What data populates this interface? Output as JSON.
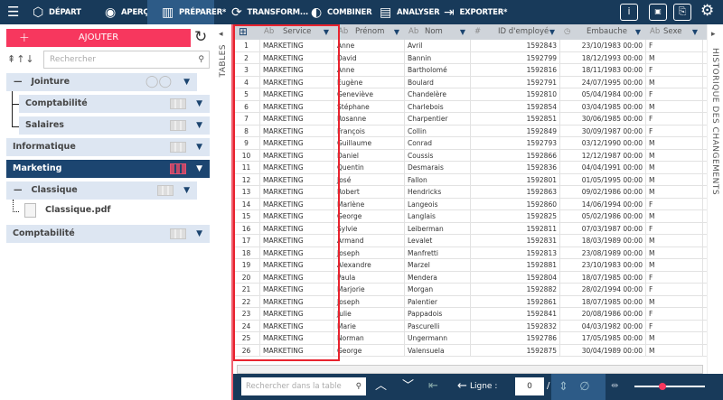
{
  "toolbar": {
    "items": [
      {
        "label": "DÉPART",
        "icon": "cube-icon",
        "glyph": "⬡"
      },
      {
        "label": "APERÇU",
        "icon": "eye-icon",
        "glyph": "◉"
      },
      {
        "label": "PRÉPARER*",
        "icon": "panel-icon",
        "glyph": "▥"
      },
      {
        "label": "TRANSFORM...",
        "icon": "transform-icon",
        "glyph": "⟳"
      },
      {
        "label": "COMBINER",
        "icon": "combine-icon",
        "glyph": "◐"
      },
      {
        "label": "ANALYSER",
        "icon": "clipboard-icon",
        "glyph": "▤"
      },
      {
        "label": "EXPORTER*",
        "icon": "export-icon",
        "glyph": "⇥"
      }
    ],
    "active": "PRÉPARER*"
  },
  "left": {
    "add_label": "AJOUTER",
    "search_placeholder": "Rechercher",
    "items": [
      {
        "label": "Jointure",
        "collapse": "—"
      },
      {
        "label": "Comptabilité"
      },
      {
        "label": "Salaires"
      },
      {
        "label": "Informatique"
      },
      {
        "label": "Marketing",
        "selected": true
      },
      {
        "label": "Classique",
        "collapse": "—"
      },
      {
        "label": "Classique.pdf"
      },
      {
        "label": "Comptabilité"
      }
    ],
    "tables_tab": "TABLES"
  },
  "grid": {
    "columns": [
      {
        "type": "Ab",
        "label": "Service"
      },
      {
        "type": "Ab",
        "label": "Prénom"
      },
      {
        "type": "Ab",
        "label": "Nom"
      },
      {
        "type": "#",
        "label": "ID d'employé"
      },
      {
        "type": "◷",
        "label": "Embauche"
      },
      {
        "type": "Ab",
        "label": "Sexe"
      }
    ],
    "rows": [
      [
        "1",
        "MARKETING",
        "Anne",
        "Avril",
        "1592843",
        "23/10/1983 00:00",
        "F"
      ],
      [
        "2",
        "MARKETING",
        "David",
        "Bannin",
        "1592799",
        "18/12/1993 00:00",
        "M"
      ],
      [
        "3",
        "MARKETING",
        "Anne",
        "Bartholomé",
        "1592816",
        "18/11/1983 00:00",
        "F"
      ],
      [
        "4",
        "MARKETING",
        "Eugène",
        "Boulard",
        "1592791",
        "24/07/1995 00:00",
        "M"
      ],
      [
        "5",
        "MARKETING",
        "Geneviève",
        "Chandelère",
        "1592810",
        "05/04/1984 00:00",
        "F"
      ],
      [
        "6",
        "MARKETING",
        "Stéphane",
        "Charlebois",
        "1592854",
        "03/04/1985 00:00",
        "M"
      ],
      [
        "7",
        "MARKETING",
        "Rosanne",
        "Charpentier",
        "1592851",
        "30/06/1985 00:00",
        "F"
      ],
      [
        "8",
        "MARKETING",
        "François",
        "Collin",
        "1592849",
        "30/09/1987 00:00",
        "F"
      ],
      [
        "9",
        "MARKETING",
        "Guillaume",
        "Conrad",
        "1592793",
        "03/12/1990 00:00",
        "M"
      ],
      [
        "10",
        "MARKETING",
        "Daniel",
        "Coussis",
        "1592866",
        "12/12/1987 00:00",
        "M"
      ],
      [
        "11",
        "MARKETING",
        "Quentin",
        "Desmarais",
        "1592836",
        "04/04/1991 00:00",
        "M"
      ],
      [
        "12",
        "MARKETING",
        "José",
        "Fallon",
        "1592801",
        "01/05/1995 00:00",
        "M"
      ],
      [
        "13",
        "MARKETING",
        "Robert",
        "Hendricks",
        "1592863",
        "09/02/1986 00:00",
        "M"
      ],
      [
        "14",
        "MARKETING",
        "Marlène",
        "Langeois",
        "1592860",
        "14/06/1994 00:00",
        "F"
      ],
      [
        "15",
        "MARKETING",
        "George",
        "Langlais",
        "1592825",
        "05/02/1986 00:00",
        "M"
      ],
      [
        "16",
        "MARKETING",
        "Sylvie",
        "Leiberman",
        "1592811",
        "07/03/1987 00:00",
        "F"
      ],
      [
        "17",
        "MARKETING",
        "Armand",
        "Levalet",
        "1592831",
        "18/03/1989 00:00",
        "M"
      ],
      [
        "18",
        "MARKETING",
        "Joseph",
        "Manfretti",
        "1592813",
        "23/08/1989 00:00",
        "M"
      ],
      [
        "19",
        "MARKETING",
        "Alexandre",
        "Marzel",
        "1592881",
        "23/10/1983 00:00",
        "M"
      ],
      [
        "20",
        "MARKETING",
        "Paula",
        "Mendera",
        "1592804",
        "18/07/1985 00:00",
        "F"
      ],
      [
        "21",
        "MARKETING",
        "Marjorie",
        "Morgan",
        "1592882",
        "28/02/1994 00:00",
        "F"
      ],
      [
        "22",
        "MARKETING",
        "Joseph",
        "Palentier",
        "1592861",
        "18/07/1985 00:00",
        "M"
      ],
      [
        "23",
        "MARKETING",
        "Julie",
        "Pappadois",
        "1592841",
        "20/08/1986 00:00",
        "F"
      ],
      [
        "24",
        "MARKETING",
        "Marie",
        "Pascurelli",
        "1592832",
        "04/03/1982 00:00",
        "F"
      ],
      [
        "25",
        "MARKETING",
        "Norman",
        "Ungermann",
        "1592786",
        "17/05/1985 00:00",
        "M"
      ],
      [
        "26",
        "MARKETING",
        "George",
        "Valensuela",
        "1592875",
        "30/04/1989 00:00",
        "M"
      ]
    ]
  },
  "history_tab": "HISTORIQUE DES CHANGEMENTS",
  "bottom": {
    "search_placeholder": "Rechercher dans la table",
    "line_label": "Ligne :",
    "line_value": "0",
    "separator": "/",
    "zoom_slider_fraction": 0.4
  },
  "colors": {
    "accent": "#f7375e",
    "navy": "#183a5a",
    "selected": "#1c4570",
    "highlight": "#e8232e"
  }
}
